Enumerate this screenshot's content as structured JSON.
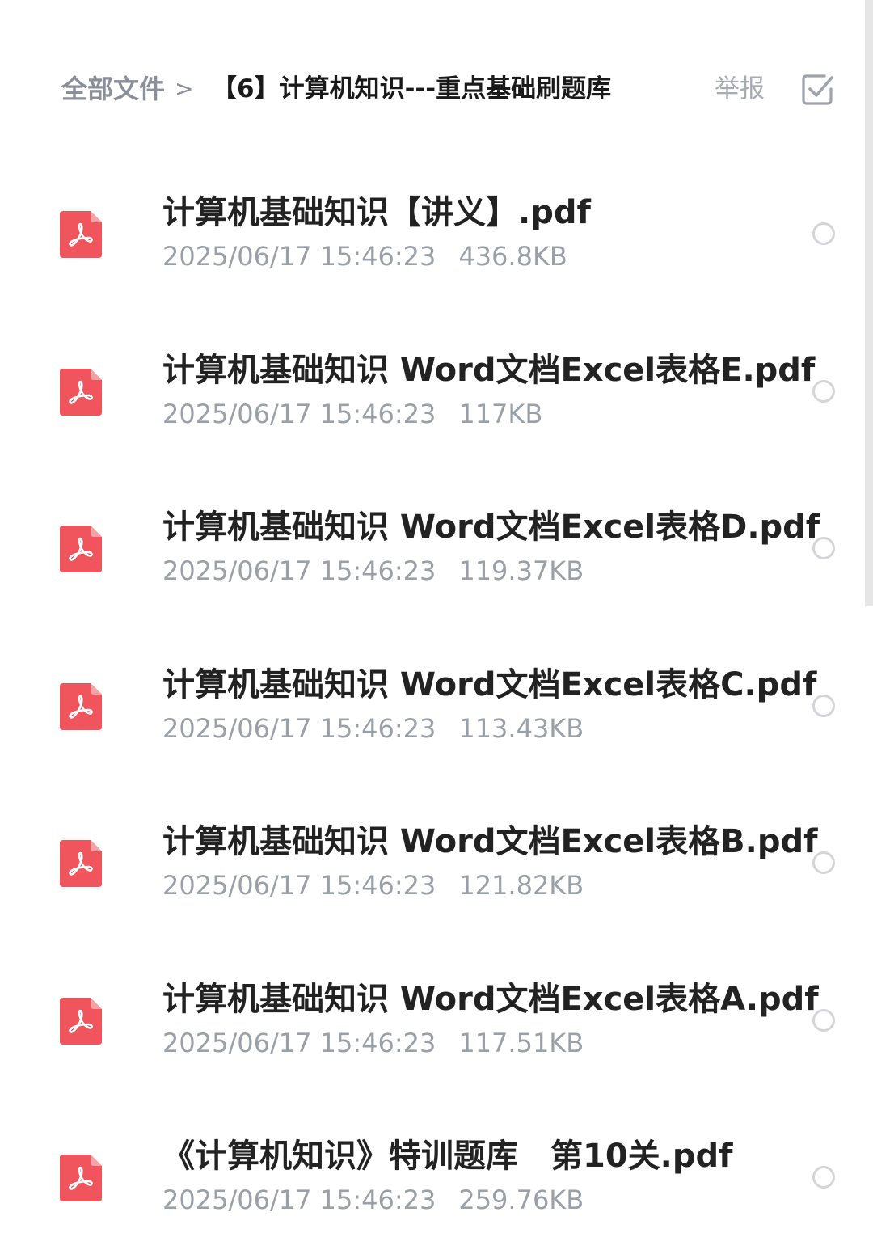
{
  "header": {
    "breadcrumb_root": "全部文件",
    "breadcrumb_separator": ">",
    "breadcrumb_current": "【6】计算机知识---重点基础刷题库",
    "report_label": "举报",
    "select_icon": "checkbox-icon"
  },
  "colors": {
    "pdf_icon": "#f0545c",
    "title_text": "#222222",
    "meta_text": "#9aa0a8",
    "muted": "#8a8f99"
  },
  "files": [
    {
      "name": "计算机基础知识【讲义】.pdf",
      "date": "2025/06/17 15:46:23",
      "size": "436.8KB",
      "icon": "pdf-icon"
    },
    {
      "name": "计算机基础知识 Word文档Excel表格E.pdf",
      "date": "2025/06/17 15:46:23",
      "size": "117KB",
      "icon": "pdf-icon"
    },
    {
      "name": "计算机基础知识 Word文档Excel表格D.pdf",
      "date": "2025/06/17 15:46:23",
      "size": "119.37KB",
      "icon": "pdf-icon"
    },
    {
      "name": "计算机基础知识 Word文档Excel表格C.pdf",
      "date": "2025/06/17 15:46:23",
      "size": "113.43KB",
      "icon": "pdf-icon"
    },
    {
      "name": "计算机基础知识 Word文档Excel表格B.pdf",
      "date": "2025/06/17 15:46:23",
      "size": "121.82KB",
      "icon": "pdf-icon"
    },
    {
      "name": "计算机基础知识 Word文档Excel表格A.pdf",
      "date": "2025/06/17 15:46:23",
      "size": "117.51KB",
      "icon": "pdf-icon"
    },
    {
      "name": "《计算机知识》特训题库　第10关.pdf",
      "date": "2025/06/17 15:46:23",
      "size": "259.76KB",
      "icon": "pdf-icon"
    }
  ]
}
